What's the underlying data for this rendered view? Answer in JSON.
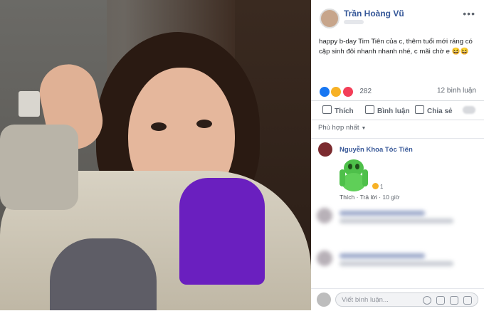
{
  "post": {
    "author": "Trần Hoàng Vũ",
    "text": "happy b-day Tim Tiên của c, thêm tuổi mới ráng có cặp sinh đôi nhanh nhanh nhé, c mãi chờ e 😆😆",
    "reaction_count": "282",
    "comment_count": "12 bình luận"
  },
  "actions": {
    "like": "Thích",
    "comment": "Bình luận",
    "share": "Chia sẻ"
  },
  "comments": {
    "sort_label": "Phù hợp nhất",
    "first": {
      "name": "Nguyễn Khoa Tóc Tiên",
      "reaction_count": "1",
      "like": "Thích",
      "reply": "Trả lời",
      "time": "10 giờ"
    }
  },
  "composer": {
    "placeholder": "Viết bình luận..."
  },
  "icons": [
    "more-icon",
    "like-icon",
    "comment-icon",
    "share-icon",
    "emoji-icon",
    "camera-icon",
    "gif-icon",
    "sticker-icon"
  ],
  "colors": {
    "link": "#365899",
    "text": "#1c1e21",
    "muted": "#606770",
    "like_reaction": "#1877f2",
    "haha_reaction": "#f7b125",
    "love_reaction": "#f33e58"
  }
}
